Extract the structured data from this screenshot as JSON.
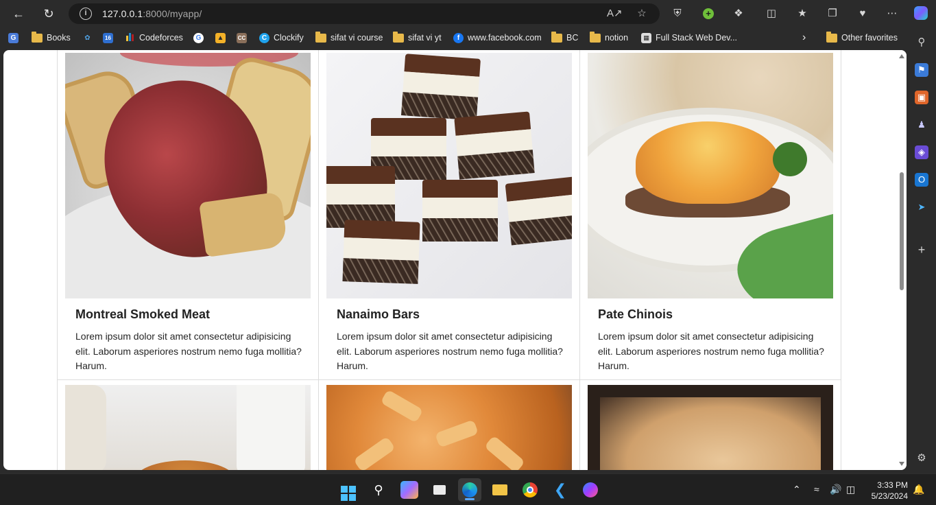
{
  "browser": {
    "url_host": "127.0.0.1",
    "url_rest": ":8000/myapp/",
    "icons": [
      "back-icon",
      "refresh-icon",
      "info-icon",
      "read-aloud-icon",
      "favorite-star-icon",
      "shield-icon",
      "extensions-icon",
      "split-screen-icon",
      "favorites-icon",
      "collections-icon",
      "health-icon",
      "more-icon",
      "copilot-icon"
    ]
  },
  "favorites": {
    "items": [
      {
        "label": "Books",
        "type": "folder"
      },
      {
        "label": "Codeforces",
        "type": "site"
      },
      {
        "label": "Clockify",
        "type": "site"
      },
      {
        "label": "sifat vi course",
        "type": "folder"
      },
      {
        "label": "sifat vi yt",
        "type": "folder"
      },
      {
        "label": "www.facebook.com",
        "type": "site"
      },
      {
        "label": "BC",
        "type": "folder"
      },
      {
        "label": "notion",
        "type": "folder"
      },
      {
        "label": "Full Stack Web Dev...",
        "type": "site"
      }
    ],
    "other": "Other favorites"
  },
  "cards": [
    {
      "title": "Montreal Smoked Meat",
      "description": "Lorem ipsum dolor sit amet consectetur adipisicing elit. Laborum asperiores nostrum nemo fuga mollitia? Harum."
    },
    {
      "title": "Nanaimo Bars",
      "description": "Lorem ipsum dolor sit amet consectetur adipisicing elit. Laborum asperiores nostrum nemo fuga mollitia? Harum."
    },
    {
      "title": "Pate Chinois",
      "description": "Lorem ipsum dolor sit amet consectetur adipisicing elit. Laborum asperiores nostrum nemo fuga mollitia? Harum."
    }
  ],
  "taskbar": {
    "apps": [
      "start-icon",
      "search-icon",
      "copilot-pre-icon",
      "task-view-icon",
      "edge-icon",
      "file-explorer-icon",
      "chrome-icon",
      "vscode-icon",
      "messenger-icon"
    ],
    "time": "3:33 PM",
    "date": "5/23/2024"
  },
  "colors": {
    "accent": "#5aa7ff",
    "folder": "#e8b94a",
    "page_bg": "#ffffff"
  }
}
